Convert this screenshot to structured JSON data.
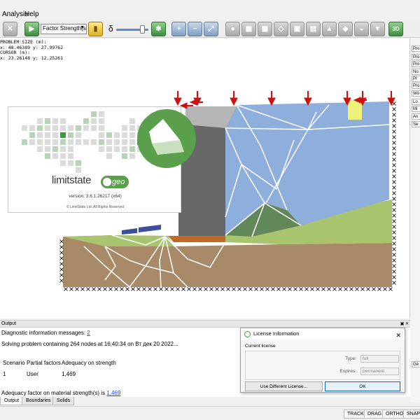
{
  "menu": {
    "analysis": "Analysis",
    "help": "Help"
  },
  "toolbar": {
    "factor_select": "Factor Strength(s)",
    "delta_symbol": "δ",
    "slider_level": 0.8,
    "view_3d": "3D"
  },
  "readout": {
    "line1": "PROBLEM SIZE (m):",
    "line2": "x: 48.46389 y: 27.99762",
    "line3": "CURSOR (m):",
    "line4": "x: 23.26148 y: 12.25261"
  },
  "splash": {
    "brand_word": "limitstate",
    "brand_suffix": "geo",
    "version": "version: 3.6.1.26217 (x64)",
    "copyright": "© LimitState Ltd. All Rights Reserved"
  },
  "right_dock": {
    "items": [
      "Pro",
      "Pro",
      "Pro",
      "No",
      "Pr",
      "Pro",
      "Wo",
      "Lo",
      "Mi",
      "An",
      "Se"
    ],
    "lower": "Ge"
  },
  "output": {
    "title": "Output",
    "diag_label": "Diagnostic information messages:",
    "diag_count": "2",
    "solving": "Solving problem containing 264 nodes at 16:40:34 on Вт дек 20 2022...",
    "headers": [
      "Scenario",
      "Partial factors",
      "Adequacy on strength"
    ],
    "row": [
      "1",
      "User",
      "1,469"
    ],
    "adequacy_label": "Adequacy factor on material strength(s) is",
    "adequacy_value": "1,469",
    "tabs": [
      "Output",
      "Boundaries",
      "Solids"
    ]
  },
  "license": {
    "title": "License Information",
    "subtitle": "Current license",
    "type_label": "Type:",
    "type_value": "full",
    "expires_label": "Expires:",
    "expires_value": "permanent",
    "btn_other": "Use Different License...",
    "btn_ok": "OK"
  },
  "statusbar": {
    "buttons": [
      "TRACK",
      "DRAG",
      "ORTHO",
      "SNAP"
    ]
  },
  "colors": {
    "blue_solid": "#8eaedb",
    "green_solid": "#a8c46e",
    "dark_green_solid": "#62885a",
    "brown_solid": "#a88a68",
    "wall": "#686868",
    "load_arrow": "#cc1111"
  }
}
